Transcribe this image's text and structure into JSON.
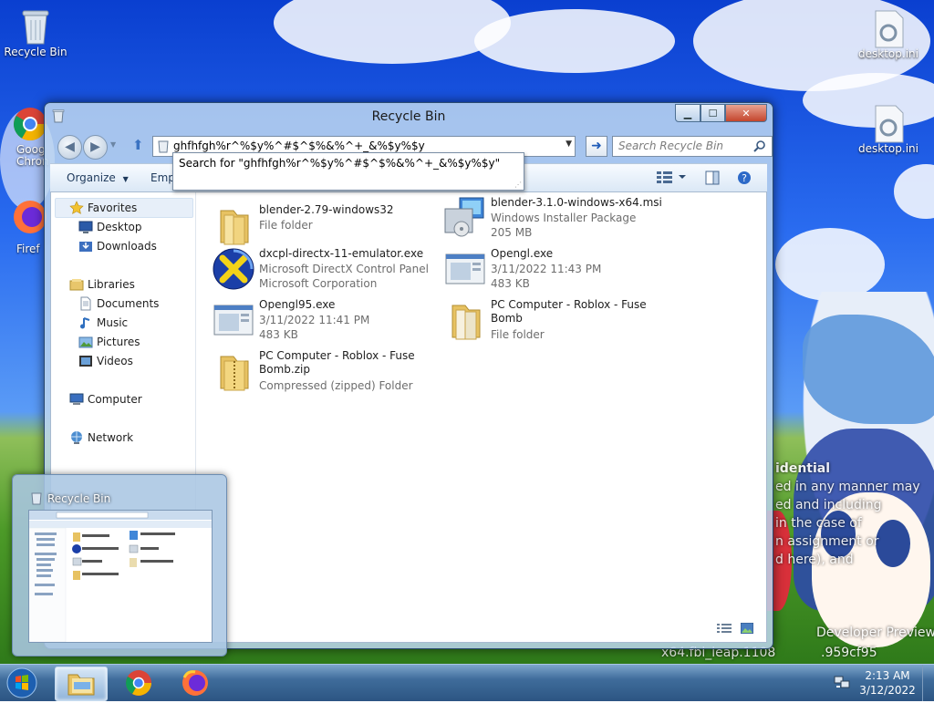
{
  "desktop": {
    "icons": [
      {
        "label": "Recycle Bin"
      },
      {
        "label": "Goog Chron"
      },
      {
        "label": "Firef"
      },
      {
        "label": "desktop.ini"
      },
      {
        "label": "desktop.ini"
      }
    ],
    "overlay_lines": [
      "idential",
      "ed in any manner may",
      "ed and including",
      "in the case of",
      "n assignment or",
      "d here), and",
      "Developer Preview",
      "x64.fbl_leap.1108",
      ".959cf95"
    ]
  },
  "window": {
    "title": "Recycle Bin",
    "address": "ghfhfgh%r^%$y%^#$^$%&%^+_&%$y%$y",
    "autocomplete": "Search for \"ghfhfgh%r^%$y%^#$^$%&%^+_&%$y%$y\"",
    "search_placeholder": "Search Recycle Bin",
    "toolbar": {
      "organize": "Organize",
      "empty": "Emp"
    },
    "nav": {
      "favorites": "Favorites",
      "desktop": "Desktop",
      "downloads": "Downloads",
      "libraries": "Libraries",
      "documents": "Documents",
      "music": "Music",
      "pictures": "Pictures",
      "videos": "Videos",
      "computer": "Computer",
      "network": "Network"
    },
    "files": [
      {
        "name": "blender-2.79-windows32",
        "meta1": "File folder",
        "meta2": "",
        "icon": "folder-icon"
      },
      {
        "name": "blender-3.1.0-windows-x64.msi",
        "meta1": "Windows Installer Package",
        "meta2": "205 MB",
        "icon": "installer-icon"
      },
      {
        "name": "dxcpl-directx-11-emulator.exe",
        "meta1": "Microsoft DirectX Control Panel",
        "meta2": "Microsoft Corporation",
        "icon": "directx-icon"
      },
      {
        "name": "Opengl.exe",
        "meta1": "3/11/2022 11:43 PM",
        "meta2": "483 KB",
        "icon": "exe-icon"
      },
      {
        "name": "Opengl95.exe",
        "meta1": "3/11/2022 11:41 PM",
        "meta2": "483 KB",
        "icon": "exe-icon"
      },
      {
        "name": "PC Computer - Roblox - Fuse Bomb",
        "meta1": "File folder",
        "meta2": "",
        "icon": "folder-icon"
      },
      {
        "name": "PC Computer - Roblox - Fuse Bomb.zip",
        "meta1": "Compressed (zipped) Folder",
        "meta2": "",
        "icon": "zip-folder-icon"
      }
    ]
  },
  "preview": {
    "title": "Recycle Bin"
  },
  "taskbar": {
    "time": "2:13 AM",
    "date": "3/12/2022"
  }
}
